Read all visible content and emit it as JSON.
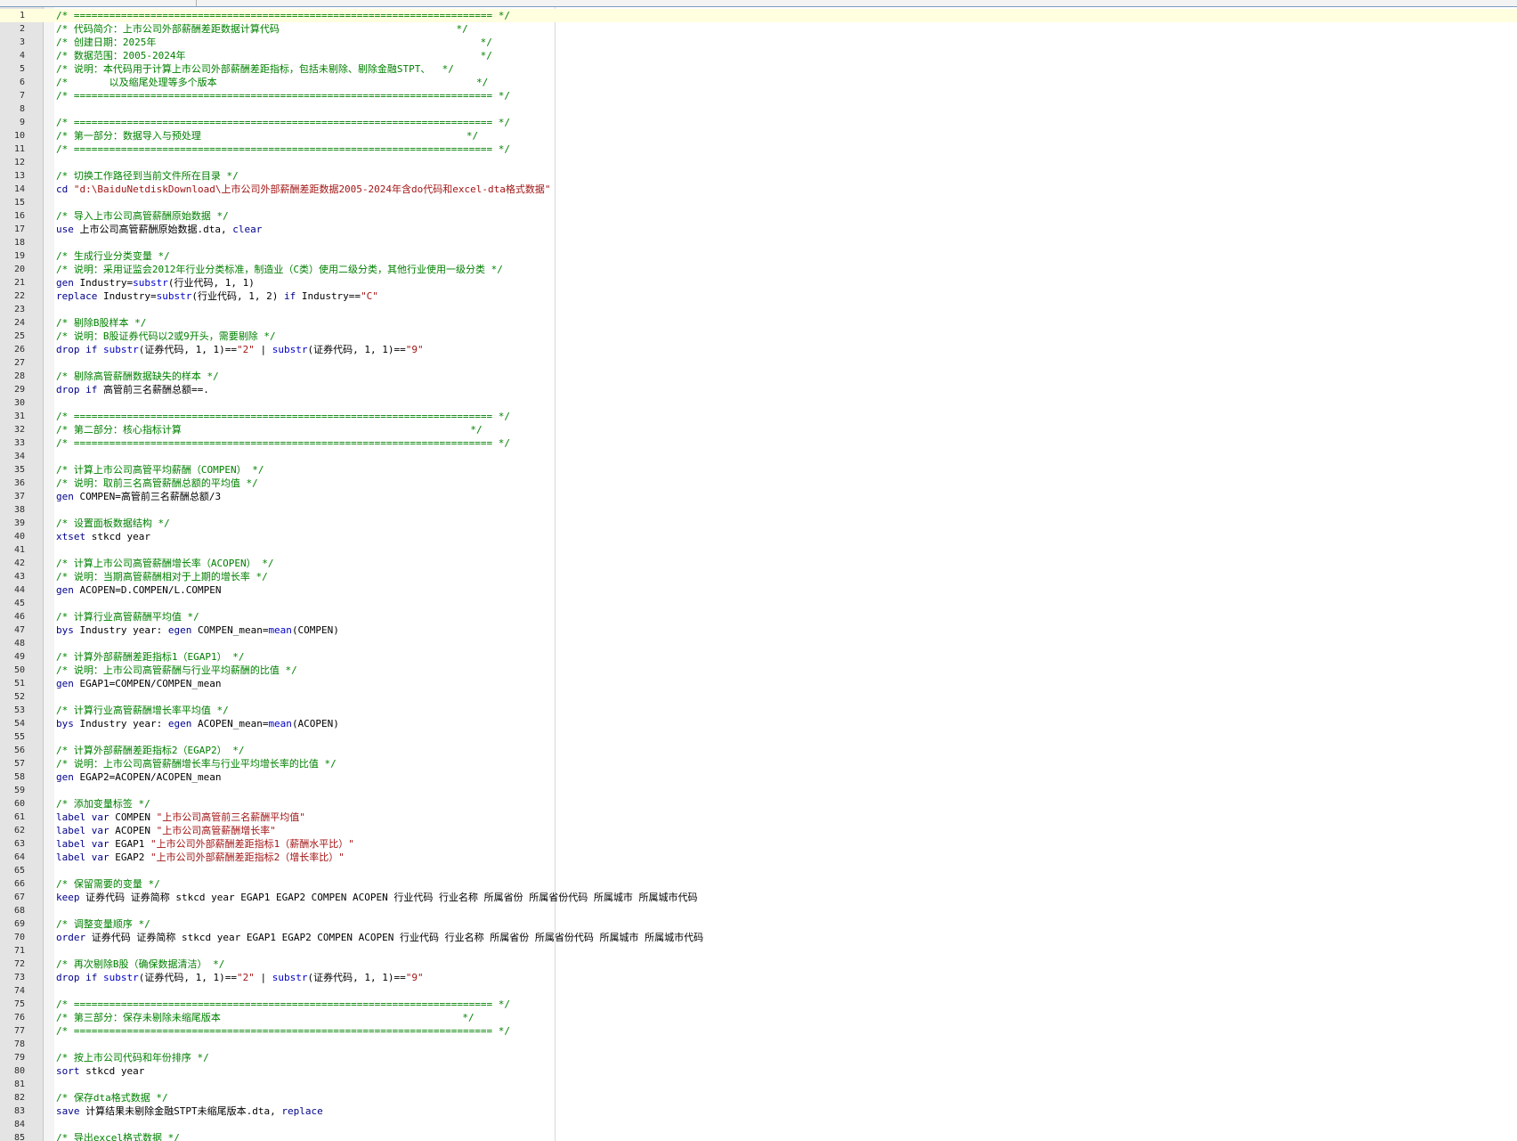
{
  "colors": {
    "comment": "#008000",
    "keyword": "#00008b",
    "function": "#0000c8",
    "string": "#a31515",
    "plain": "#000000",
    "line_number": "#2b2b2b",
    "gutter": "#e4e4e4",
    "current_line": "#ffffe0"
  },
  "editor": {
    "current_line": 1,
    "lines": [
      {
        "n": "1",
        "tokens": [
          [
            "c",
            "/* ======================================================================= */"
          ]
        ]
      },
      {
        "n": "2",
        "tokens": [
          [
            "c",
            "/* 代码简介：上市公司外部薪酬差距数据计算代码                              */"
          ]
        ]
      },
      {
        "n": "3",
        "tokens": [
          [
            "c",
            "/* 创建日期：2025年                                                       */"
          ]
        ]
      },
      {
        "n": "4",
        "tokens": [
          [
            "c",
            "/* 数据范围：2005-2024年                                                  */"
          ]
        ]
      },
      {
        "n": "5",
        "tokens": [
          [
            "c",
            "/* 说明：本代码用于计算上市公司外部薪酬差距指标，包括未剔除、剔除金融STPT、  */"
          ]
        ]
      },
      {
        "n": "6",
        "tokens": [
          [
            "c",
            "/*       以及缩尾处理等多个版本                                            */"
          ]
        ]
      },
      {
        "n": "7",
        "tokens": [
          [
            "c",
            "/* ======================================================================= */"
          ]
        ]
      },
      {
        "n": "8",
        "tokens": []
      },
      {
        "n": "9",
        "tokens": [
          [
            "c",
            "/* ======================================================================= */"
          ]
        ]
      },
      {
        "n": "10",
        "tokens": [
          [
            "c",
            "/* 第一部分：数据导入与预处理                                             */"
          ]
        ]
      },
      {
        "n": "11",
        "tokens": [
          [
            "c",
            "/* ======================================================================= */"
          ]
        ]
      },
      {
        "n": "12",
        "tokens": []
      },
      {
        "n": "13",
        "tokens": [
          [
            "c",
            "/* 切换工作路径到当前文件所在目录 */"
          ]
        ]
      },
      {
        "n": "14",
        "tokens": [
          [
            "k",
            "cd "
          ],
          [
            "s",
            "\"d:\\BaiduNetdiskDownload\\上市公司外部薪酬差距数据2005-2024年含do代码和excel-dta格式数据\""
          ]
        ]
      },
      {
        "n": "15",
        "tokens": []
      },
      {
        "n": "16",
        "tokens": [
          [
            "c",
            "/* 导入上市公司高管薪酬原始数据 */"
          ]
        ]
      },
      {
        "n": "17",
        "tokens": [
          [
            "k",
            "use"
          ],
          [
            "p",
            " 上市公司高管薪酬原始数据.dta, "
          ],
          [
            "k",
            "clear"
          ]
        ]
      },
      {
        "n": "18",
        "tokens": []
      },
      {
        "n": "19",
        "tokens": [
          [
            "c",
            "/* 生成行业分类变量 */"
          ]
        ]
      },
      {
        "n": "20",
        "tokens": [
          [
            "c",
            "/* 说明：采用证监会2012年行业分类标准，制造业（C类）使用二级分类，其他行业使用一级分类 */"
          ]
        ]
      },
      {
        "n": "21",
        "tokens": [
          [
            "k",
            "gen"
          ],
          [
            "p",
            " Industry="
          ],
          [
            "f",
            "substr"
          ],
          [
            "p",
            "(行业代码, 1, 1)"
          ]
        ]
      },
      {
        "n": "22",
        "tokens": [
          [
            "k",
            "replace"
          ],
          [
            "p",
            " Industry="
          ],
          [
            "f",
            "substr"
          ],
          [
            "p",
            "(行业代码, 1, 2) "
          ],
          [
            "k",
            "if"
          ],
          [
            "p",
            " Industry=="
          ],
          [
            "s",
            "\"C\""
          ]
        ]
      },
      {
        "n": "23",
        "tokens": []
      },
      {
        "n": "24",
        "tokens": [
          [
            "c",
            "/* 剔除B股样本 */"
          ]
        ]
      },
      {
        "n": "25",
        "tokens": [
          [
            "c",
            "/* 说明：B股证券代码以2或9开头，需要剔除 */"
          ]
        ]
      },
      {
        "n": "26",
        "tokens": [
          [
            "k",
            "drop"
          ],
          [
            "p",
            " "
          ],
          [
            "k",
            "if"
          ],
          [
            "p",
            " "
          ],
          [
            "f",
            "substr"
          ],
          [
            "p",
            "(证券代码, 1, 1)=="
          ],
          [
            "s",
            "\"2\""
          ],
          [
            "p",
            " | "
          ],
          [
            "f",
            "substr"
          ],
          [
            "p",
            "(证券代码, 1, 1)=="
          ],
          [
            "s",
            "\"9\""
          ]
        ]
      },
      {
        "n": "27",
        "tokens": []
      },
      {
        "n": "28",
        "tokens": [
          [
            "c",
            "/* 剔除高管薪酬数据缺失的样本 */"
          ]
        ]
      },
      {
        "n": "29",
        "tokens": [
          [
            "k",
            "drop"
          ],
          [
            "p",
            " "
          ],
          [
            "k",
            "if"
          ],
          [
            "p",
            " 高管前三名薪酬总额==."
          ]
        ]
      },
      {
        "n": "30",
        "tokens": []
      },
      {
        "n": "31",
        "tokens": [
          [
            "c",
            "/* ======================================================================= */"
          ]
        ]
      },
      {
        "n": "32",
        "tokens": [
          [
            "c",
            "/* 第二部分：核心指标计算                                                 */"
          ]
        ]
      },
      {
        "n": "33",
        "tokens": [
          [
            "c",
            "/* ======================================================================= */"
          ]
        ]
      },
      {
        "n": "34",
        "tokens": []
      },
      {
        "n": "35",
        "tokens": [
          [
            "c",
            "/* 计算上市公司高管平均薪酬（COMPEN） */"
          ]
        ]
      },
      {
        "n": "36",
        "tokens": [
          [
            "c",
            "/* 说明：取前三名高管薪酬总额的平均值 */"
          ]
        ]
      },
      {
        "n": "37",
        "tokens": [
          [
            "k",
            "gen"
          ],
          [
            "p",
            " COMPEN=高管前三名薪酬总额/3"
          ]
        ]
      },
      {
        "n": "38",
        "tokens": []
      },
      {
        "n": "39",
        "tokens": [
          [
            "c",
            "/* 设置面板数据结构 */"
          ]
        ]
      },
      {
        "n": "40",
        "tokens": [
          [
            "k",
            "xtset"
          ],
          [
            "p",
            " stkcd year"
          ]
        ]
      },
      {
        "n": "41",
        "tokens": []
      },
      {
        "n": "42",
        "tokens": [
          [
            "c",
            "/* 计算上市公司高管薪酬增长率（ACOPEN） */"
          ]
        ]
      },
      {
        "n": "43",
        "tokens": [
          [
            "c",
            "/* 说明：当期高管薪酬相对于上期的增长率 */"
          ]
        ]
      },
      {
        "n": "44",
        "tokens": [
          [
            "k",
            "gen"
          ],
          [
            "p",
            " ACOPEN=D.COMPEN/L.COMPEN"
          ]
        ]
      },
      {
        "n": "45",
        "tokens": []
      },
      {
        "n": "46",
        "tokens": [
          [
            "c",
            "/* 计算行业高管薪酬平均值 */"
          ]
        ]
      },
      {
        "n": "47",
        "tokens": [
          [
            "k",
            "bys"
          ],
          [
            "p",
            " Industry year: "
          ],
          [
            "k",
            "egen"
          ],
          [
            "p",
            " COMPEN_mean="
          ],
          [
            "f",
            "mean"
          ],
          [
            "p",
            "(COMPEN)"
          ]
        ]
      },
      {
        "n": "48",
        "tokens": []
      },
      {
        "n": "49",
        "tokens": [
          [
            "c",
            "/* 计算外部薪酬差距指标1（EGAP1） */"
          ]
        ]
      },
      {
        "n": "50",
        "tokens": [
          [
            "c",
            "/* 说明：上市公司高管薪酬与行业平均薪酬的比值 */"
          ]
        ]
      },
      {
        "n": "51",
        "tokens": [
          [
            "k",
            "gen"
          ],
          [
            "p",
            " EGAP1=COMPEN/COMPEN_mean"
          ]
        ]
      },
      {
        "n": "52",
        "tokens": []
      },
      {
        "n": "53",
        "tokens": [
          [
            "c",
            "/* 计算行业高管薪酬增长率平均值 */"
          ]
        ]
      },
      {
        "n": "54",
        "tokens": [
          [
            "k",
            "bys"
          ],
          [
            "p",
            " Industry year: "
          ],
          [
            "k",
            "egen"
          ],
          [
            "p",
            " ACOPEN_mean="
          ],
          [
            "f",
            "mean"
          ],
          [
            "p",
            "(ACOPEN)"
          ]
        ]
      },
      {
        "n": "55",
        "tokens": []
      },
      {
        "n": "56",
        "tokens": [
          [
            "c",
            "/* 计算外部薪酬差距指标2（EGAP2） */"
          ]
        ]
      },
      {
        "n": "57",
        "tokens": [
          [
            "c",
            "/* 说明：上市公司高管薪酬增长率与行业平均增长率的比值 */"
          ]
        ]
      },
      {
        "n": "58",
        "tokens": [
          [
            "k",
            "gen"
          ],
          [
            "p",
            " EGAP2=ACOPEN/ACOPEN_mean"
          ]
        ]
      },
      {
        "n": "59",
        "tokens": []
      },
      {
        "n": "60",
        "tokens": [
          [
            "c",
            "/* 添加变量标签 */"
          ]
        ]
      },
      {
        "n": "61",
        "tokens": [
          [
            "k",
            "label var"
          ],
          [
            "p",
            " COMPEN "
          ],
          [
            "s",
            "\"上市公司高管前三名薪酬平均值\""
          ]
        ]
      },
      {
        "n": "62",
        "tokens": [
          [
            "k",
            "label var"
          ],
          [
            "p",
            " ACOPEN "
          ],
          [
            "s",
            "\"上市公司高管薪酬增长率\""
          ]
        ]
      },
      {
        "n": "63",
        "tokens": [
          [
            "k",
            "label var"
          ],
          [
            "p",
            " EGAP1 "
          ],
          [
            "s",
            "\"上市公司外部薪酬差距指标1（薪酬水平比）\""
          ]
        ]
      },
      {
        "n": "64",
        "tokens": [
          [
            "k",
            "label var"
          ],
          [
            "p",
            " EGAP2 "
          ],
          [
            "s",
            "\"上市公司外部薪酬差距指标2（增长率比）\""
          ]
        ]
      },
      {
        "n": "65",
        "tokens": []
      },
      {
        "n": "66",
        "tokens": [
          [
            "c",
            "/* 保留需要的变量 */"
          ]
        ]
      },
      {
        "n": "67",
        "tokens": [
          [
            "k",
            "keep"
          ],
          [
            "p",
            " 证券代码 证券简称 stkcd year EGAP1 EGAP2 COMPEN ACOPEN 行业代码 行业名称 所属省份 所属省份代码 所属城市 所属城市代码"
          ]
        ]
      },
      {
        "n": "68",
        "tokens": []
      },
      {
        "n": "69",
        "tokens": [
          [
            "c",
            "/* 调整变量顺序 */"
          ]
        ]
      },
      {
        "n": "70",
        "tokens": [
          [
            "k",
            "order"
          ],
          [
            "p",
            " 证券代码 证券简称 stkcd year EGAP1 EGAP2 COMPEN ACOPEN 行业代码 行业名称 所属省份 所属省份代码 所属城市 所属城市代码"
          ]
        ]
      },
      {
        "n": "71",
        "tokens": []
      },
      {
        "n": "72",
        "tokens": [
          [
            "c",
            "/* 再次剔除B股（确保数据清洁） */"
          ]
        ]
      },
      {
        "n": "73",
        "tokens": [
          [
            "k",
            "drop"
          ],
          [
            "p",
            " "
          ],
          [
            "k",
            "if"
          ],
          [
            "p",
            " "
          ],
          [
            "f",
            "substr"
          ],
          [
            "p",
            "(证券代码, 1, 1)=="
          ],
          [
            "s",
            "\"2\""
          ],
          [
            "p",
            " | "
          ],
          [
            "f",
            "substr"
          ],
          [
            "p",
            "(证券代码, 1, 1)=="
          ],
          [
            "s",
            "\"9\""
          ]
        ]
      },
      {
        "n": "74",
        "tokens": []
      },
      {
        "n": "75",
        "tokens": [
          [
            "c",
            "/* ======================================================================= */"
          ]
        ]
      },
      {
        "n": "76",
        "tokens": [
          [
            "c",
            "/* 第三部分：保存未剔除未缩尾版本                                         */"
          ]
        ]
      },
      {
        "n": "77",
        "tokens": [
          [
            "c",
            "/* ======================================================================= */"
          ]
        ]
      },
      {
        "n": "78",
        "tokens": []
      },
      {
        "n": "79",
        "tokens": [
          [
            "c",
            "/* 按上市公司代码和年份排序 */"
          ]
        ]
      },
      {
        "n": "80",
        "tokens": [
          [
            "k",
            "sort"
          ],
          [
            "p",
            " stkcd year"
          ]
        ]
      },
      {
        "n": "81",
        "tokens": []
      },
      {
        "n": "82",
        "tokens": [
          [
            "c",
            "/* 保存dta格式数据 */"
          ]
        ]
      },
      {
        "n": "83",
        "tokens": [
          [
            "k",
            "save"
          ],
          [
            "p",
            " 计算结果未剔除金融STPT未缩尾版本.dta, "
          ],
          [
            "k",
            "replace"
          ]
        ]
      },
      {
        "n": "84",
        "tokens": []
      },
      {
        "n": "85",
        "tokens": [
          [
            "c",
            "/* 导出excel格式数据 */"
          ]
        ]
      }
    ]
  }
}
